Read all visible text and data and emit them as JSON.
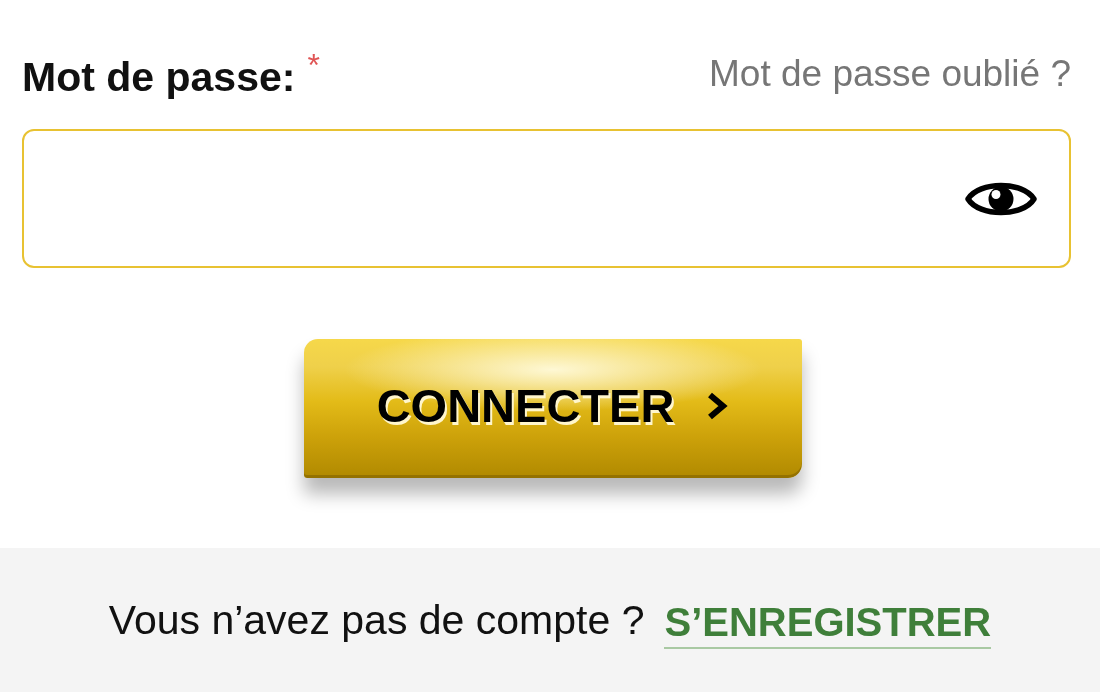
{
  "password_field": {
    "label": "Mot de passe:",
    "required_mark": "*",
    "forgot_link": "Mot de passe oublié ?"
  },
  "login_button": {
    "label": "CONNECTER"
  },
  "signup": {
    "prompt": "Vous n’avez pas de compte ?",
    "link": "S’ENREGISTRER"
  }
}
